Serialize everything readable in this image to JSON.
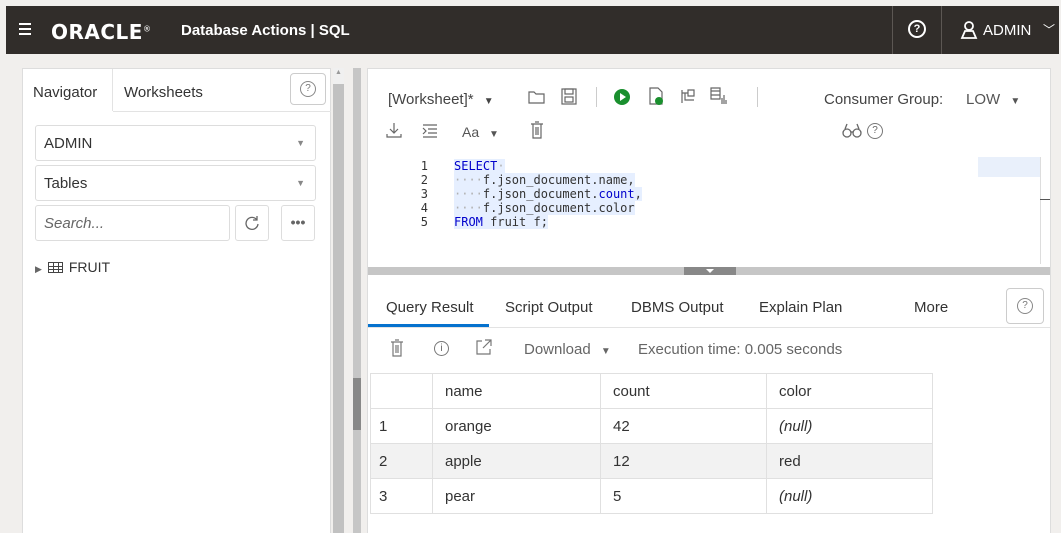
{
  "header": {
    "brand": "ORACLE",
    "brand_sup": "®",
    "app_title": "Database Actions | SQL",
    "user": "ADMIN"
  },
  "navigator": {
    "tabs": [
      "Navigator",
      "Worksheets"
    ],
    "schema": "ADMIN",
    "object_type": "Tables",
    "search_placeholder": "Search...",
    "tree": [
      {
        "label": "FRUIT"
      }
    ]
  },
  "worksheet": {
    "name": "[Worksheet]*",
    "consumer_group_label": "Consumer Group:",
    "consumer_group_value": "LOW",
    "format_label": "Aa"
  },
  "editor": {
    "lines": [
      {
        "n": "1"
      },
      {
        "n": "2"
      },
      {
        "n": "3"
      },
      {
        "n": "4"
      },
      {
        "n": "5"
      }
    ],
    "code": {
      "l1_kw": "SELECT",
      "l2": "f.json_document.name,",
      "l3a": "f.json_document.",
      "l3b": "count",
      "l3c": ",",
      "l4": "f.json_document.color",
      "l5_kw": "FROM",
      "l5_rest": " fruit f;"
    }
  },
  "results": {
    "tabs": [
      "Query Result",
      "Script Output",
      "DBMS Output",
      "Explain Plan",
      "More"
    ],
    "download_label": "Download",
    "execution_time": "Execution time: 0.005 seconds",
    "columns": [
      "name",
      "count",
      "color"
    ],
    "rows": [
      {
        "n": "1",
        "name": "orange",
        "count": "42",
        "color": "(null)"
      },
      {
        "n": "2",
        "name": "apple",
        "count": "12",
        "color": "red"
      },
      {
        "n": "3",
        "name": "pear",
        "count": "5",
        "color": "(null)"
      }
    ]
  },
  "colors": {
    "topbar": "#312d2a",
    "accent": "#0572ce",
    "run": "#1a8f2e",
    "keyword": "#0000cc"
  }
}
